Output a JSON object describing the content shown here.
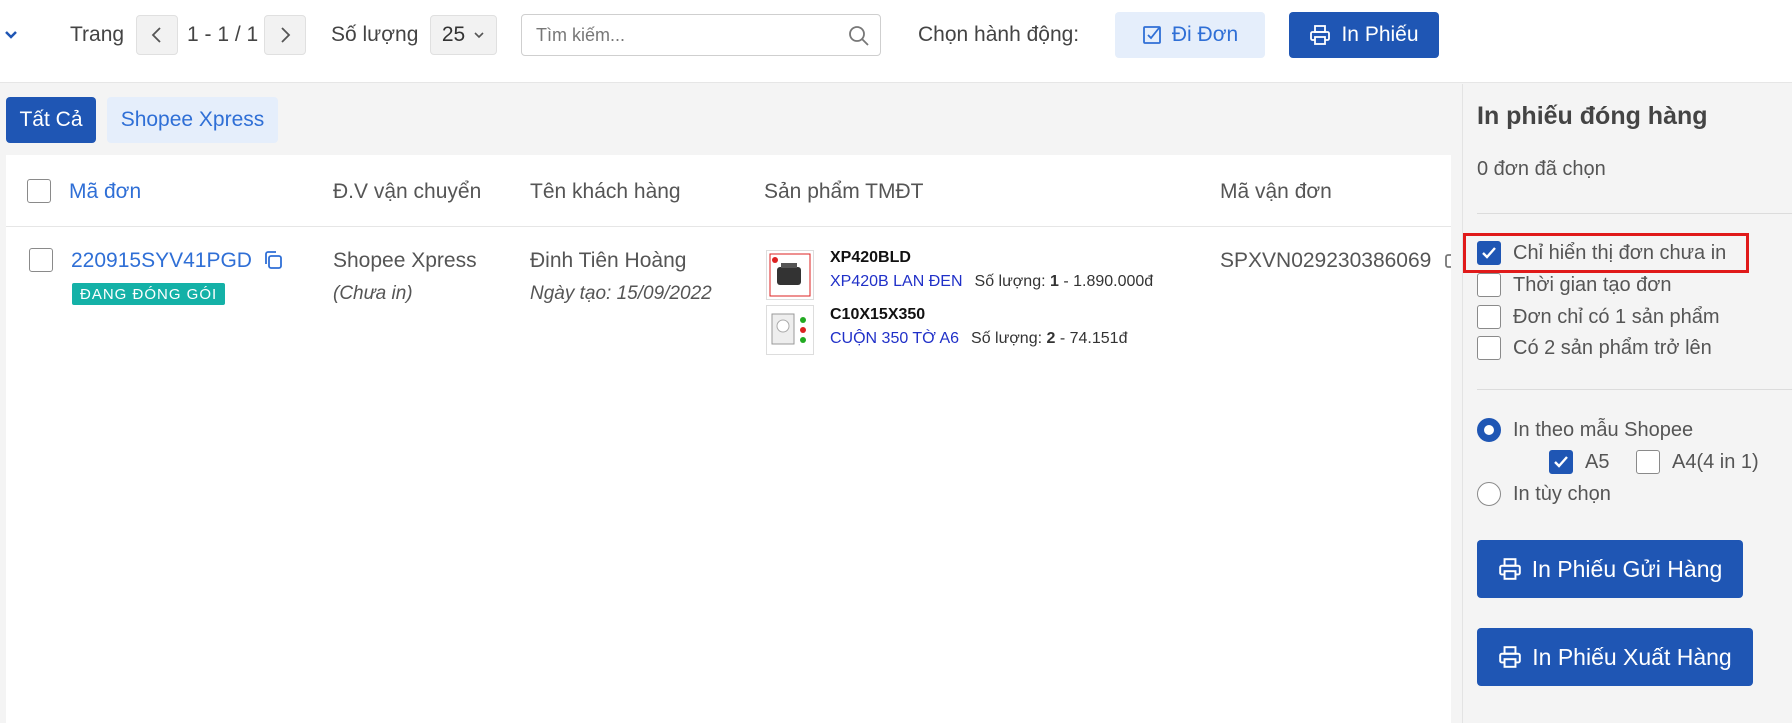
{
  "toolbar": {
    "page_label": "Trang",
    "page_indicator": "1 - 1 / 1",
    "quantity_label": "Số lượng",
    "quantity_value": "25",
    "search_placeholder": "Tìm kiếm...",
    "action_label": "Chọn hành động:",
    "di_don_label": "Đi Đơn",
    "in_phieu_label": "In Phiếu"
  },
  "tabs": [
    {
      "label": "Tất Cả",
      "active": true
    },
    {
      "label": "Shopee Xpress",
      "active": false
    }
  ],
  "table": {
    "headers": {
      "order_code": "Mã đơn",
      "carrier": "Đ.V vận chuyển",
      "customer": "Tên khách hàng",
      "products": "Sản phẩm TMĐT",
      "tracking": "Mã vận đơn"
    },
    "rows": [
      {
        "order_code": "220915SYV41PGD",
        "status": "ĐANG ĐÓNG GÓI",
        "carrier": "Shopee Xpress",
        "print_status": "(Chưa in)",
        "customer": "Đinh Tiên Hoàng",
        "created": "Ngày tạo: 15/09/2022",
        "tracking": "SPXVN029230386069",
        "products": [
          {
            "sku": "XP420BLD",
            "name": "XP420B LAN ĐEN",
            "qty_label": "Số lượng:",
            "qty": "1",
            "price": "- 1.890.000đ"
          },
          {
            "sku": "C10X15X350",
            "name": "CUỘN 350 TỜ A6",
            "qty_label": "Số lượng:",
            "qty": "2",
            "price": "- 74.151đ"
          }
        ]
      }
    ]
  },
  "panel": {
    "title": "In phiếu đóng hàng",
    "selected_count": "0 đơn đã chọn",
    "filters": [
      {
        "label": "Chỉ hiển thị đơn chưa in",
        "checked": true,
        "highlighted": true
      },
      {
        "label": "Thời gian tạo đơn",
        "checked": false
      },
      {
        "label": "Đơn chỉ có 1 sản phẩm",
        "checked": false
      },
      {
        "label": "Có 2 sản phẩm trở lên",
        "checked": false
      }
    ],
    "print_mode": {
      "shopee_template_label": "In theo mẫu Shopee",
      "shopee_template_selected": true,
      "sizes": [
        {
          "label": "A5",
          "checked": true
        },
        {
          "label": "A4(4 in 1)",
          "checked": false
        }
      ],
      "custom_label": "In tùy chọn",
      "custom_selected": false
    },
    "print_shipping_label": "In Phiếu Gửi Hàng",
    "print_export_label": "In Phiếu Xuất Hàng"
  },
  "colors": {
    "primary": "#1f56b4",
    "link": "#2f6fd6",
    "badge": "#14b1a7",
    "highlight_border": "#e01a1a"
  }
}
